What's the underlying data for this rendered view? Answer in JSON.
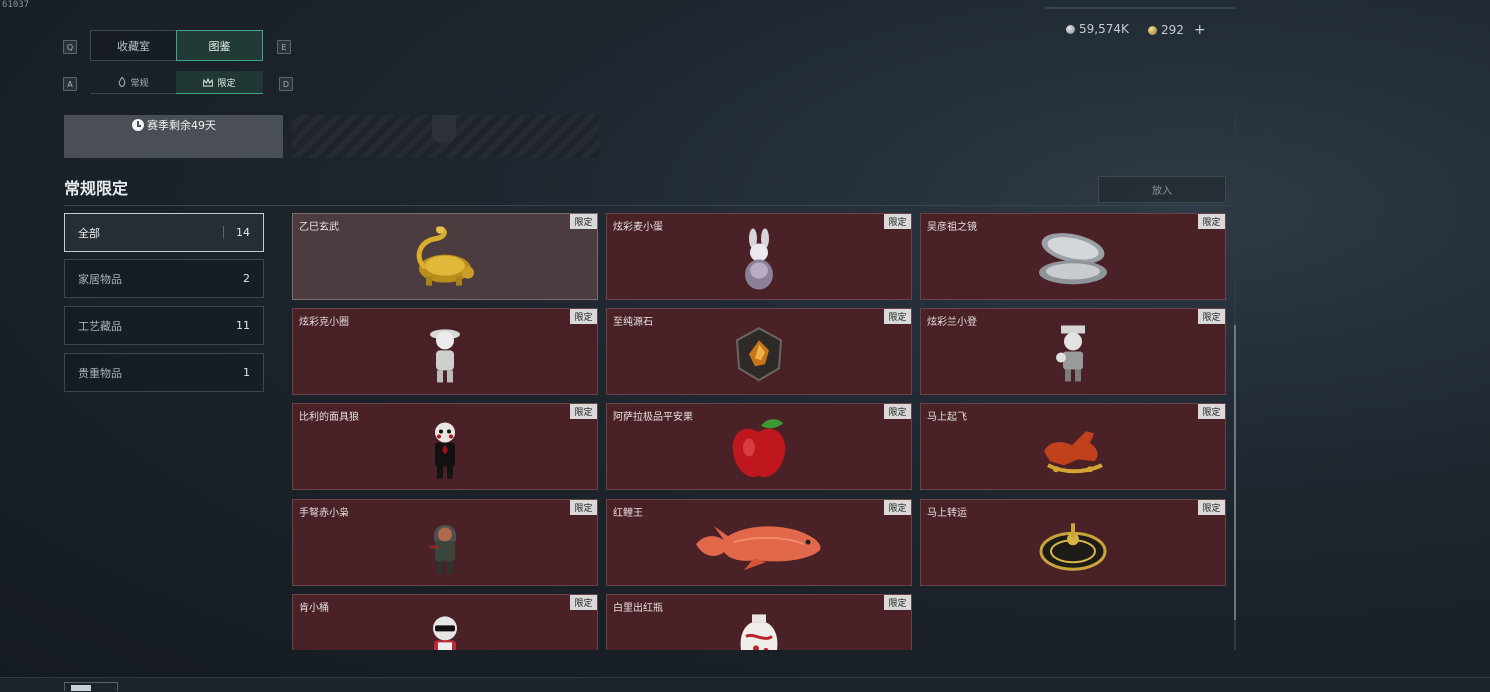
{
  "corner_id": "61037",
  "currency": {
    "silver": "59,574K",
    "gold": "292",
    "add_symbol": "+"
  },
  "keys": {
    "tab_prev": "Q",
    "tab_next": "E",
    "sub_prev": "A",
    "sub_next": "D"
  },
  "tabs": [
    {
      "label": "收藏室"
    },
    {
      "label": "图鉴",
      "active": true
    }
  ],
  "subtabs": [
    {
      "label": "常规"
    },
    {
      "label": "限定",
      "active": true
    }
  ],
  "season": {
    "text": "赛季剩余49天"
  },
  "section_title": "常规限定",
  "put_button": "放入",
  "categories": [
    {
      "label": "全部",
      "count": "14",
      "active": true
    },
    {
      "label": "家居物品",
      "count": "2"
    },
    {
      "label": "工艺藏品",
      "count": "11"
    },
    {
      "label": "贵重物品",
      "count": "1"
    }
  ],
  "items": [
    {
      "name": "乙巳玄武",
      "tag": "限定",
      "selected": true,
      "icon": "golden-tortoise-icon"
    },
    {
      "name": "炫彩麦小蛋",
      "tag": "限定",
      "icon": "rabbit-egg-icon"
    },
    {
      "name": "吴彦祖之镜",
      "tag": "限定",
      "icon": "compact-mirror-icon"
    },
    {
      "name": "炫彩克小圈",
      "tag": "限定",
      "icon": "figure-white-icon"
    },
    {
      "name": "至纯源石",
      "tag": "限定",
      "icon": "source-stone-icon"
    },
    {
      "name": "炫彩兰小登",
      "tag": "限定",
      "icon": "figure-hat-icon"
    },
    {
      "name": "比利的面具狼",
      "tag": "限定",
      "icon": "billy-puppet-icon"
    },
    {
      "name": "阿萨拉极品平安果",
      "tag": "限定",
      "icon": "apple-icon"
    },
    {
      "name": "马上起飞",
      "tag": "限定",
      "icon": "red-horse-icon"
    },
    {
      "name": "手弩赤小枭",
      "tag": "限定",
      "icon": "hooded-figure-icon"
    },
    {
      "name": "红鲤王",
      "tag": "限定",
      "icon": "red-carp-icon"
    },
    {
      "name": "马上转运",
      "tag": "限定",
      "icon": "compass-icon"
    },
    {
      "name": "肯小桶",
      "tag": "限定",
      "icon": "figure-sunglasses-icon"
    },
    {
      "name": "白里出红瓶",
      "tag": "限定",
      "icon": "porcelain-vase-icon"
    }
  ]
}
